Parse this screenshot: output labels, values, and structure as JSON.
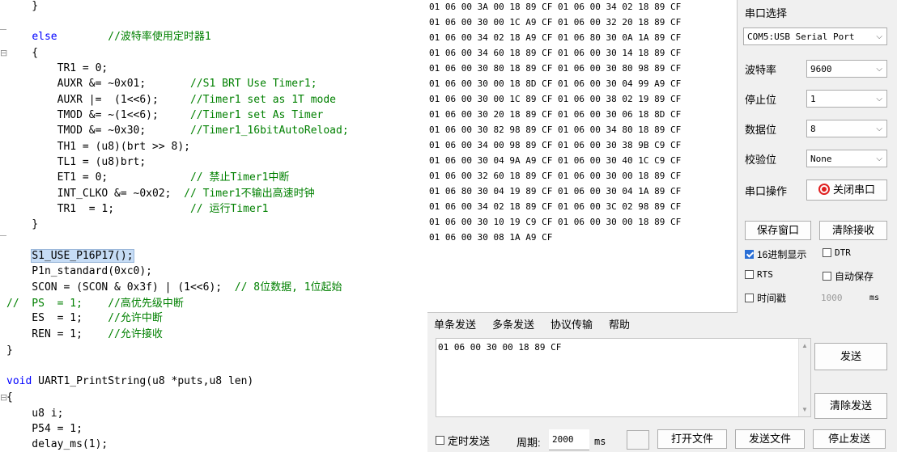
{
  "editor": {
    "lines": [
      {
        "gutter": "",
        "segments": [
          {
            "t": "    }",
            "c": ""
          }
        ]
      },
      {
        "gutter": "",
        "segments": []
      },
      {
        "gutter": "",
        "segments": [
          {
            "t": "    ",
            "c": ""
          },
          {
            "t": "else",
            "c": "kw"
          },
          {
            "t": "        ",
            "c": ""
          },
          {
            "t": "//波特率使用定时器1",
            "c": "cm"
          }
        ]
      },
      {
        "gutter": "⊟",
        "segments": [
          {
            "t": "    {",
            "c": ""
          }
        ]
      },
      {
        "gutter": "",
        "segments": [
          {
            "t": "        TR1 = 0;",
            "c": ""
          }
        ]
      },
      {
        "gutter": "",
        "segments": [
          {
            "t": "        AUXR &= ~0x01;       ",
            "c": ""
          },
          {
            "t": "//S1 BRT Use Timer1;",
            "c": "cm"
          }
        ]
      },
      {
        "gutter": "",
        "segments": [
          {
            "t": "        AUXR |=  (1<<6);     ",
            "c": ""
          },
          {
            "t": "//Timer1 set as 1T mode",
            "c": "cm"
          }
        ]
      },
      {
        "gutter": "",
        "segments": [
          {
            "t": "        TMOD &= ~(1<<6);     ",
            "c": ""
          },
          {
            "t": "//Timer1 set As Timer",
            "c": "cm"
          }
        ]
      },
      {
        "gutter": "",
        "segments": [
          {
            "t": "        TMOD &= ~0x30;       ",
            "c": ""
          },
          {
            "t": "//Timer1_16bitAutoReload;",
            "c": "cm"
          }
        ]
      },
      {
        "gutter": "",
        "segments": [
          {
            "t": "        TH1 = (u8)(brt >> 8);",
            "c": ""
          }
        ]
      },
      {
        "gutter": "",
        "segments": [
          {
            "t": "        TL1 = (u8)brt;",
            "c": ""
          }
        ]
      },
      {
        "gutter": "",
        "segments": [
          {
            "t": "        ET1 = 0;             ",
            "c": ""
          },
          {
            "t": "// 禁止Timer1中断",
            "c": "cm"
          }
        ]
      },
      {
        "gutter": "",
        "segments": [
          {
            "t": "        INT_CLKO &= ~0x02;  ",
            "c": ""
          },
          {
            "t": "// Timer1不输出高速时钟",
            "c": "cm"
          }
        ]
      },
      {
        "gutter": "",
        "segments": [
          {
            "t": "        TR1  = 1;            ",
            "c": ""
          },
          {
            "t": "// 运行Timer1",
            "c": "cm"
          }
        ]
      },
      {
        "gutter": "",
        "segments": [
          {
            "t": "    }",
            "c": ""
          }
        ]
      },
      {
        "gutter": "",
        "segments": []
      },
      {
        "gutter": "",
        "segments": [
          {
            "t": "    ",
            "c": ""
          },
          {
            "t": "S1_USE_P16P17();",
            "c": "hl"
          }
        ]
      },
      {
        "gutter": "",
        "segments": [
          {
            "t": "    P1n_standard(0xc0);",
            "c": ""
          }
        ]
      },
      {
        "gutter": "",
        "segments": [
          {
            "t": "    SCON = (SCON & 0x3f) | (1<<6);  ",
            "c": ""
          },
          {
            "t": "// 8位数据, 1位起始",
            "c": "cm"
          }
        ]
      },
      {
        "gutter": "",
        "segments": [
          {
            "t": "//  PS  = 1;    ",
            "c": "cm"
          },
          {
            "t": "//高优先级中断",
            "c": "cm"
          }
        ]
      },
      {
        "gutter": "",
        "segments": [
          {
            "t": "    ES  = 1;    ",
            "c": ""
          },
          {
            "t": "//允许中断",
            "c": "cm"
          }
        ]
      },
      {
        "gutter": "",
        "segments": [
          {
            "t": "    REN = 1;    ",
            "c": ""
          },
          {
            "t": "//允许接收",
            "c": "cm"
          }
        ]
      },
      {
        "gutter": "",
        "segments": [
          {
            "t": "}",
            "c": ""
          }
        ]
      },
      {
        "gutter": "",
        "segments": []
      },
      {
        "gutter": "",
        "segments": [
          {
            "t": "void",
            "c": "kw"
          },
          {
            "t": " UART1_PrintString(u8 *puts,u8 len)",
            "c": ""
          }
        ]
      },
      {
        "gutter": "⊟",
        "segments": [
          {
            "t": "{",
            "c": ""
          }
        ]
      },
      {
        "gutter": "",
        "segments": [
          {
            "t": "    u8 i;",
            "c": ""
          }
        ]
      },
      {
        "gutter": "",
        "segments": [
          {
            "t": "    P54 = 1;",
            "c": ""
          }
        ]
      },
      {
        "gutter": "",
        "segments": [
          {
            "t": "    delay_ms(1);",
            "c": ""
          }
        ]
      }
    ]
  },
  "receive": {
    "lines": [
      "01 06 00 3A 00 18 89 CF 01 06 00 34 02 18 89 CF",
      "01 06 00 30 00 1C A9 CF 01 06 00 32 20 18 89 CF",
      "01 06 00 34 02 18 A9 CF 01 06 80 30 0A 1A 89 CF",
      "01 06 00 34 60 18 89 CF 01 06 00 30 14 18 89 CF",
      "01 06 00 30 80 18 89 CF 01 06 00 30 80 98 89 CF",
      "01 06 00 30 00 18 8D CF 01 06 00 30 04 99 A9 CF",
      "01 06 00 30 00 1C 89 CF 01 06 00 38 02 19 89 CF",
      "01 06 00 30 20 18 89 CF 01 06 00 30 06 18 8D CF",
      "01 06 00 30 82 98 89 CF 01 06 00 34 80 18 89 CF",
      "01 06 00 34 00 98 89 CF 01 06 00 30 38 9B C9 CF",
      "01 06 00 30 04 9A A9 CF 01 06 00 30 40 1C C9 CF",
      "01 06 00 32 60 18 89 CF 01 06 00 30 00 18 89 CF",
      "01 06 80 30 04 19 89 CF 01 06 00 30 04 1A 89 CF",
      "01 06 00 34 02 18 89 CF 01 06 00 3C 02 98 89 CF",
      "01 06 00 30 10 19 C9 CF 01 06 00 30 00 18 89 CF",
      "01 06 00 30 08 1A A9 CF"
    ]
  },
  "panel": {
    "port_label": "串口选择",
    "port_value": "COM5:USB Serial Port",
    "baud_label": "波特率",
    "baud_value": "9600",
    "stop_label": "停止位",
    "stop_value": "1",
    "data_label": "数据位",
    "data_value": "8",
    "parity_label": "校验位",
    "parity_value": "None",
    "op_label": "串口操作",
    "close_port": "关闭串口",
    "save_window": "保存窗口",
    "clear_recv": "清除接收",
    "hex_display": "16进制显示",
    "dtr": "DTR",
    "rts": "RTS",
    "auto_save": "自动保存",
    "timestamp": "时间戳",
    "timestamp_value": "1000",
    "timestamp_unit": "ms",
    "send_btn": "发送",
    "clear_send": "清除发送"
  },
  "tabs": [
    "单条发送",
    "多条发送",
    "协议传输",
    "帮助"
  ],
  "send": {
    "text": "01 06 00 30 00 18 89 CF"
  },
  "bottom": {
    "timed_send": "定时发送",
    "period_label": "周期:",
    "period_value": "2000",
    "period_unit": "ms",
    "open_file": "打开文件",
    "send_file": "发送文件",
    "stop_send": "停止发送"
  },
  "colors": {
    "keyword": "#0000ff",
    "comment": "#008000",
    "highlight": "#c6dcf5",
    "record_red": "#e02020"
  }
}
